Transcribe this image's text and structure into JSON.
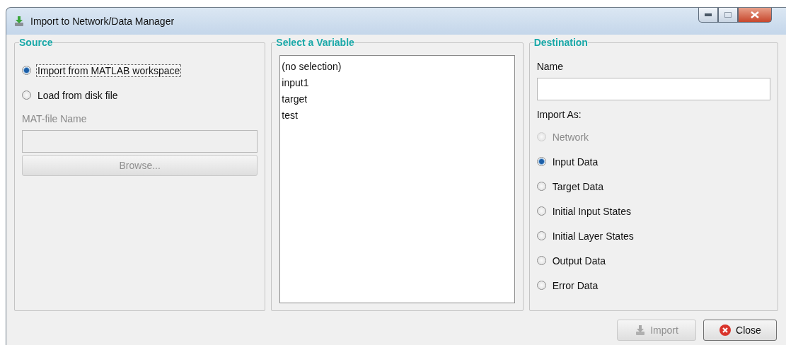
{
  "window": {
    "title": "Import to Network/Data Manager"
  },
  "source": {
    "title": "Source",
    "options": [
      {
        "label": "Import from MATLAB workspace",
        "selected": true,
        "focused": true
      },
      {
        "label": "Load from disk file",
        "selected": false,
        "focused": false
      }
    ],
    "file_label": "MAT-file Name",
    "file_disabled": true,
    "browse_button": {
      "label": "Browse...",
      "disabled": true
    }
  },
  "variables": {
    "title": "Select a Variable",
    "items": [
      {
        "label": "(no selection)",
        "selected": false
      },
      {
        "label": "input1",
        "selected": false
      },
      {
        "label": "target",
        "selected": false
      },
      {
        "label": "test",
        "selected": false
      }
    ]
  },
  "destination": {
    "title": "Destination",
    "name_label": "Name",
    "import_as_label": "Import As:",
    "options": [
      {
        "label": "Network",
        "selected": false,
        "disabled": true
      },
      {
        "label": "Input Data",
        "selected": true,
        "disabled": false
      },
      {
        "label": "Target Data",
        "selected": false,
        "disabled": false
      },
      {
        "label": "Initial Input States",
        "selected": false,
        "disabled": false
      },
      {
        "label": "Initial Layer States",
        "selected": false,
        "disabled": false
      },
      {
        "label": "Output Data",
        "selected": false,
        "disabled": false
      },
      {
        "label": "Error Data",
        "selected": false,
        "disabled": false
      }
    ]
  },
  "buttons": [
    {
      "label": "Import",
      "kind": "import",
      "disabled": true
    },
    {
      "label": "Close",
      "kind": "close",
      "disabled": false
    }
  ]
}
